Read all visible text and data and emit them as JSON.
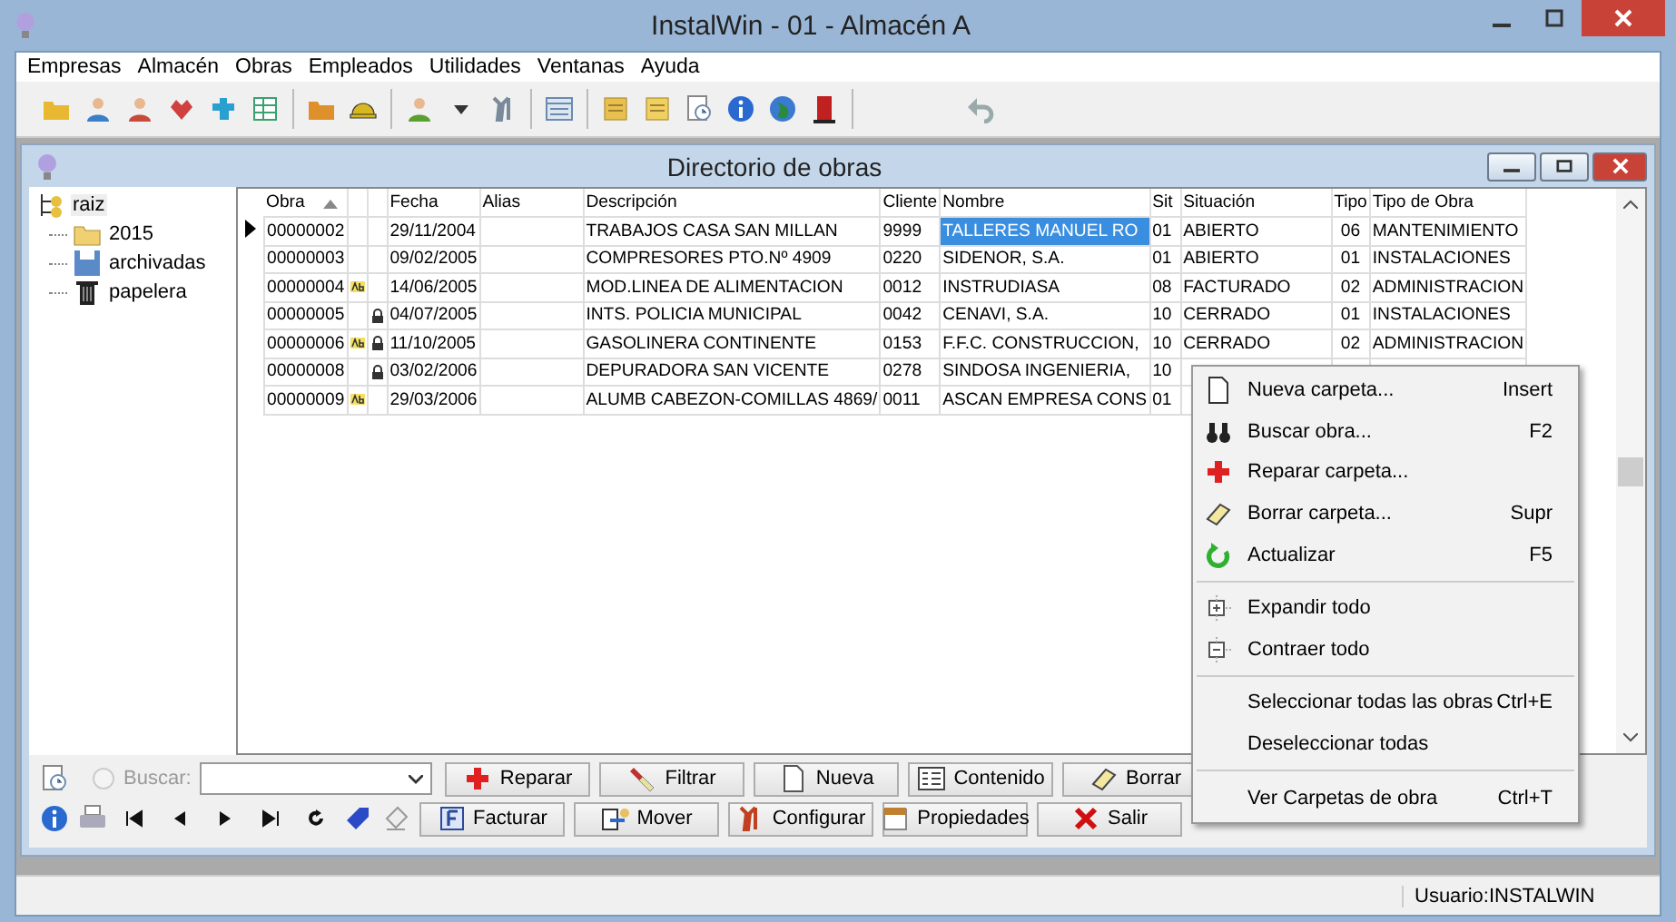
{
  "window": {
    "title": "InstalWin - 01 - Almacén A"
  },
  "menu": [
    "Empresas",
    "Almacén",
    "Obras",
    "Empleados",
    "Utilidades",
    "Ventanas",
    "Ayuda"
  ],
  "child_window": {
    "title": "Directorio de obras"
  },
  "tree": [
    {
      "label": "raiz",
      "expanded": true,
      "selected": true,
      "children": [
        {
          "label": "2015",
          "selected": false
        },
        {
          "label": "archivadas",
          "selected": false
        },
        {
          "label": "papelera",
          "selected": false
        }
      ]
    }
  ],
  "table": {
    "columns": [
      "Obra",
      "Fecha",
      "Alias",
      "Descripción",
      "Cliente",
      "Nombre",
      "Sit",
      "Situación",
      "Tipo",
      "Tipo de Obra"
    ],
    "rows": [
      {
        "obra": "00000002",
        "ab": false,
        "locked": false,
        "fecha": "29/11/2004",
        "descripcion": "TRABAJOS CASA SAN MILLAN",
        "cliente": "9999",
        "nombre": "TALLERES MANUEL RO",
        "sit": "01",
        "situacion": "ABIERTO",
        "tipo": "06",
        "tipo_obra": "MANTENIMIENTO",
        "selected": true
      },
      {
        "obra": "00000003",
        "ab": false,
        "locked": false,
        "fecha": "09/02/2005",
        "descripcion": "COMPRESORES PTO.Nº 4909",
        "cliente": "0220",
        "nombre": "SIDENOR, S.A.",
        "sit": "01",
        "situacion": "ABIERTO",
        "tipo": "01",
        "tipo_obra": "INSTALACIONES",
        "selected": false
      },
      {
        "obra": "00000004",
        "ab": true,
        "locked": false,
        "fecha": "14/06/2005",
        "descripcion": "MOD.LINEA DE ALIMENTACION",
        "cliente": "0012",
        "nombre": "INSTRUDIASA",
        "sit": "08",
        "situacion": "FACTURADO",
        "tipo": "02",
        "tipo_obra": "ADMINISTRACION",
        "selected": false
      },
      {
        "obra": "00000005",
        "ab": false,
        "locked": true,
        "fecha": "04/07/2005",
        "descripcion": "INTS. POLICIA MUNICIPAL",
        "cliente": "0042",
        "nombre": "CENAVI, S.A.",
        "sit": "10",
        "situacion": "CERRADO",
        "tipo": "01",
        "tipo_obra": "INSTALACIONES",
        "selected": false
      },
      {
        "obra": "00000006",
        "ab": true,
        "locked": true,
        "fecha": "11/10/2005",
        "descripcion": "GASOLINERA CONTINENTE",
        "cliente": "0153",
        "nombre": "F.F.C. CONSTRUCCION,",
        "sit": "10",
        "situacion": "CERRADO",
        "tipo": "02",
        "tipo_obra": "ADMINISTRACION",
        "selected": false
      },
      {
        "obra": "00000008",
        "ab": false,
        "locked": true,
        "fecha": "03/02/2006",
        "descripcion": "DEPURADORA SAN VICENTE",
        "cliente": "0278",
        "nombre": "SINDOSA INGENIERIA,",
        "sit": "10",
        "selected": false
      },
      {
        "obra": "00000009",
        "ab": true,
        "locked": false,
        "fecha": "29/03/2006",
        "descripcion": "ALUMB CABEZON-COMILLAS 4869/",
        "cliente": "0011",
        "nombre": "ASCAN EMPRESA CONS",
        "sit": "01",
        "selected": false
      }
    ]
  },
  "search": {
    "label": "Buscar:",
    "disabled": true,
    "checked": false
  },
  "buttons": [
    [
      "Reparar",
      "Filtrar",
      "Nueva",
      "Contenido",
      "Borrar"
    ],
    [
      "Facturar",
      "Mover",
      "Configurar",
      "Propiedades",
      "Salir"
    ]
  ],
  "context_menu": [
    [
      {
        "label": "Nueva carpeta...",
        "shortcut": "Insert"
      },
      {
        "label": "Buscar obra...",
        "shortcut": "F2"
      },
      {
        "label": "Reparar carpeta..."
      },
      {
        "label": "Borrar carpeta...",
        "shortcut": "Supr"
      },
      {
        "label": "Actualizar",
        "shortcut": "F5"
      }
    ],
    [
      {
        "label": "Expandir todo"
      },
      {
        "label": "Contraer todo"
      }
    ],
    [
      {
        "label": "Seleccionar todas las obras",
        "shortcut": "Ctrl+E"
      },
      {
        "label": "Deseleccionar todas"
      }
    ],
    [
      {
        "label": "Ver Carpetas de obra",
        "shortcut": "Ctrl+T"
      }
    ]
  ],
  "status_bar": {
    "user": "Usuario:INSTALWIN"
  }
}
